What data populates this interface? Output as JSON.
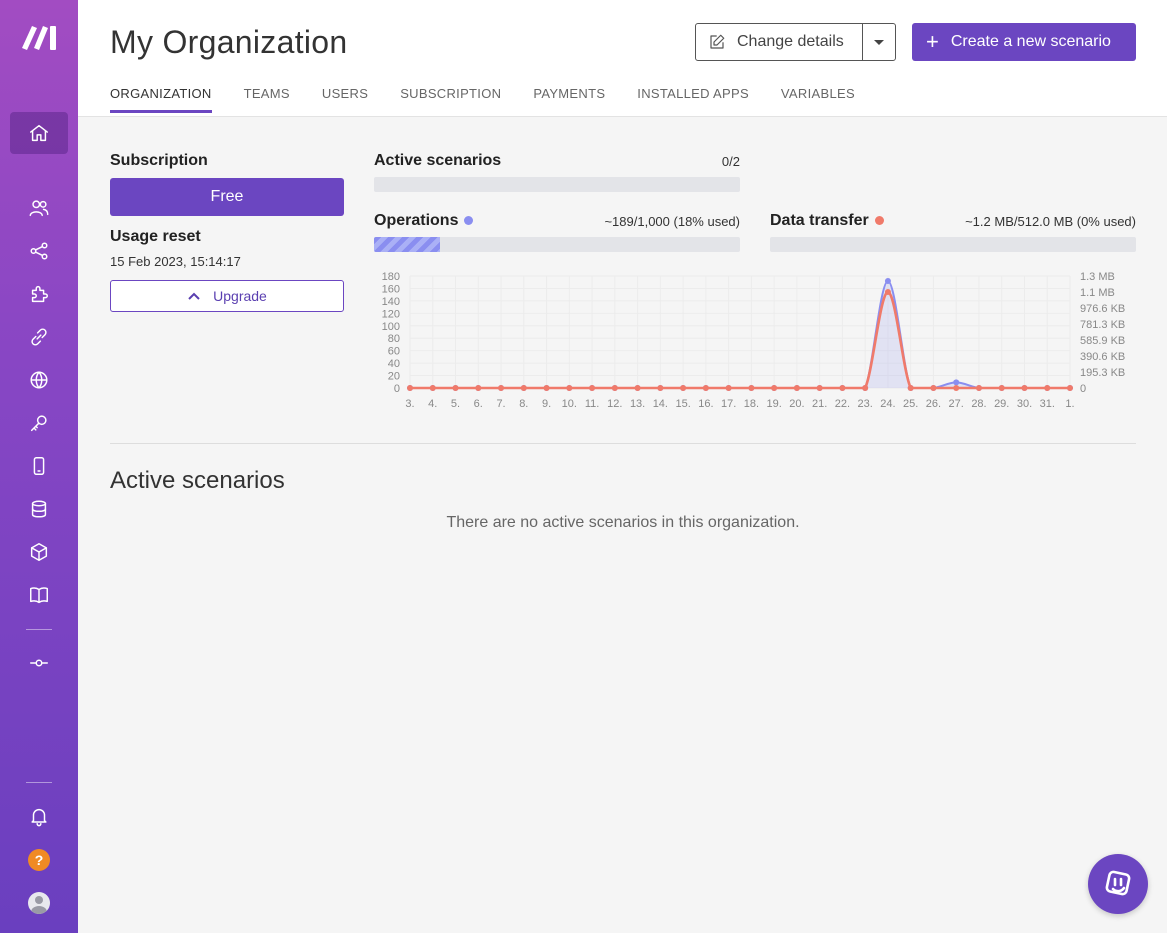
{
  "header": {
    "title": "My Organization",
    "change_details_label": "Change details",
    "create_scenario_label": "Create a new scenario",
    "tabs": [
      {
        "label": "ORGANIZATION",
        "active": true
      },
      {
        "label": "TEAMS"
      },
      {
        "label": "USERS"
      },
      {
        "label": "SUBSCRIPTION"
      },
      {
        "label": "PAYMENTS"
      },
      {
        "label": "INSTALLED APPS"
      },
      {
        "label": "VARIABLES"
      }
    ]
  },
  "sidebar": {
    "items": [
      {
        "icon": "home-icon",
        "active": true
      },
      {
        "icon": "users-icon"
      },
      {
        "icon": "share-icon"
      },
      {
        "icon": "puzzle-icon"
      },
      {
        "icon": "link-icon"
      },
      {
        "icon": "globe-icon"
      },
      {
        "icon": "key-icon"
      },
      {
        "icon": "mobile-icon"
      },
      {
        "icon": "database-icon"
      },
      {
        "icon": "cube-icon"
      },
      {
        "icon": "book-icon"
      },
      {
        "icon": "flow-icon"
      },
      {
        "icon": "bell-icon"
      },
      {
        "icon": "help-icon",
        "text": "?"
      },
      {
        "icon": "avatar"
      }
    ],
    "accent": "#8746c4"
  },
  "subscription": {
    "label": "Subscription",
    "plan": "Free",
    "usage_reset_label": "Usage reset",
    "usage_reset_date": "15 Feb 2023, 15:14:17",
    "upgrade_label": "Upgrade"
  },
  "meters": {
    "active_scenarios": {
      "label": "Active scenarios",
      "value": "0/2",
      "fraction": 0
    },
    "operations": {
      "label": "Operations",
      "value": "~189/1,000 (18% used)",
      "fraction": 0.18,
      "color": "#8a8ef0"
    },
    "data_transfer": {
      "label": "Data transfer",
      "value": "~1.2 MB/512.0 MB (0% used)",
      "fraction": 0,
      "color": "#f07a6a"
    }
  },
  "chart_data": {
    "type": "line",
    "categories": [
      "3.",
      "4.",
      "5.",
      "6.",
      "7.",
      "8.",
      "9.",
      "10.",
      "11.",
      "12.",
      "13.",
      "14.",
      "15.",
      "16.",
      "17.",
      "18.",
      "19.",
      "20.",
      "21.",
      "22.",
      "23.",
      "24.",
      "25.",
      "26.",
      "27.",
      "28.",
      "29.",
      "30.",
      "31.",
      "1."
    ],
    "y_left_ticks": [
      "180",
      "160",
      "140",
      "120",
      "100",
      "80",
      "60",
      "40",
      "20",
      "0"
    ],
    "y_left_lim": [
      0,
      180
    ],
    "y_right_ticks": [
      "1.3 MB",
      "1.1 MB",
      "976.6 KB",
      "781.3 KB",
      "585.9 KB",
      "390.6 KB",
      "195.3 KB",
      "0"
    ],
    "y_right_lim": [
      0,
      1.4
    ],
    "series": [
      {
        "name": "Operations",
        "axis": "left",
        "color": "#8a8ef0",
        "values": [
          0,
          0,
          0,
          0,
          0,
          0,
          0,
          0,
          0,
          0,
          0,
          0,
          0,
          0,
          0,
          0,
          0,
          0,
          0,
          0,
          0,
          172,
          0,
          0,
          9,
          0,
          0,
          0,
          0,
          0
        ]
      },
      {
        "name": "Data transfer",
        "axis": "right",
        "color": "#f07a6a",
        "values": [
          0,
          0,
          0,
          0,
          0,
          0,
          0,
          0,
          0,
          0,
          0,
          0,
          0,
          0,
          0,
          0,
          0,
          0,
          0,
          0,
          0,
          1.2,
          0,
          0,
          0,
          0,
          0,
          0,
          0,
          0
        ]
      }
    ],
    "grid": true
  },
  "active_scenarios_section": {
    "title": "Active scenarios",
    "empty_message": "There are no active scenarios in this organization."
  },
  "colors": {
    "primary": "#6b46c1"
  }
}
